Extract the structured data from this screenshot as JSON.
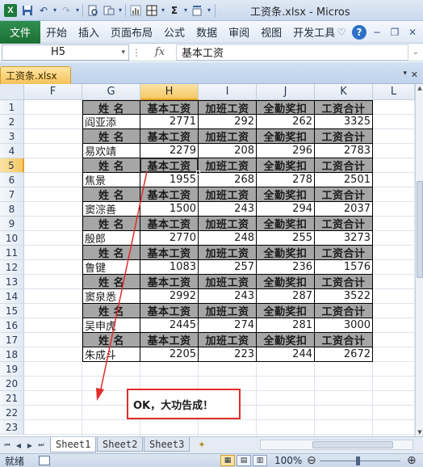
{
  "window": {
    "title": "工资条.xlsx - Micros"
  },
  "quick_access": [
    "save-icon",
    "undo-icon",
    "redo-icon",
    "print-preview-icon",
    "format-icon",
    "chart-icon",
    "table-icon",
    "sum-icon",
    "sort-icon"
  ],
  "ribbon": {
    "file_tab": "文件",
    "tabs": [
      "开始",
      "插入",
      "页面布局",
      "公式",
      "数据",
      "审阅",
      "视图",
      "开发工具"
    ]
  },
  "formula_bar": {
    "name_box": "H5",
    "fx": "fx",
    "content": "基本工资"
  },
  "workbook_tab": {
    "label": "工资条.xlsx"
  },
  "columns": [
    "F",
    "G",
    "H",
    "I",
    "J",
    "K",
    "L"
  ],
  "selected_column": "H",
  "rows": [
    "1",
    "2",
    "3",
    "4",
    "5",
    "6",
    "7",
    "8",
    "9",
    "10",
    "11",
    "12",
    "13",
    "14",
    "15",
    "16",
    "17",
    "18",
    "19",
    "20",
    "21",
    "22",
    "23"
  ],
  "selected_row": "5",
  "table": {
    "header": [
      "姓  名",
      "基本工资",
      "加班工资",
      "全勤奖扣",
      "工资合计"
    ],
    "records": [
      {
        "name": "阎亚添",
        "base": "2771",
        "overtime": "292",
        "bonus": "262",
        "total": "3325"
      },
      {
        "name": "易欢靖",
        "base": "2279",
        "overtime": "208",
        "bonus": "296",
        "total": "2783"
      },
      {
        "name": "焦景",
        "base": "1955",
        "overtime": "268",
        "bonus": "278",
        "total": "2501"
      },
      {
        "name": "窦淙善",
        "base": "1500",
        "overtime": "243",
        "bonus": "294",
        "total": "2037"
      },
      {
        "name": "殷郎",
        "base": "2770",
        "overtime": "248",
        "bonus": "255",
        "total": "3273"
      },
      {
        "name": "鲁键",
        "base": "1083",
        "overtime": "257",
        "bonus": "236",
        "total": "1576"
      },
      {
        "name": "窦泉悉",
        "base": "2992",
        "overtime": "243",
        "bonus": "287",
        "total": "3522"
      },
      {
        "name": "吴申虎",
        "base": "2445",
        "overtime": "274",
        "bonus": "281",
        "total": "3000"
      },
      {
        "name": "朱成斗",
        "base": "2205",
        "overtime": "223",
        "bonus": "244",
        "total": "2672"
      }
    ]
  },
  "callout": {
    "text": "OK，大功告成！",
    "border_color": "#e22b2b"
  },
  "sheets": {
    "tabs": [
      "Sheet1",
      "Sheet2",
      "Sheet3"
    ],
    "active": "Sheet1"
  },
  "status_bar": {
    "ready": "就绪",
    "zoom": "100%"
  },
  "colors": {
    "header_fill": "#a6a6a6",
    "file_tab": "#1d6e35",
    "selection": "#f5c764"
  }
}
